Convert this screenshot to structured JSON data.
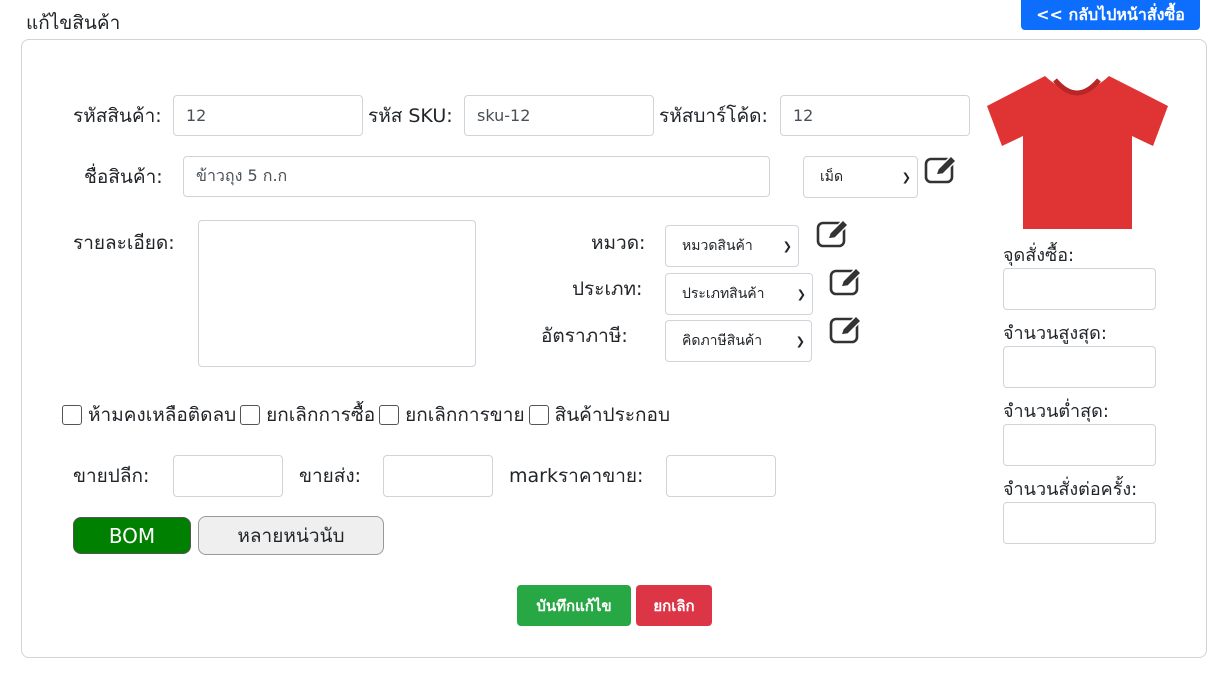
{
  "page": {
    "title": "แก้ไขสินค้า",
    "back_button": "<< กลับไปหน้าสั่งซื้อ"
  },
  "form": {
    "product_code": {
      "label": "รหัสสินค้า:",
      "value": "12"
    },
    "sku": {
      "label": "รหัส SKU:",
      "value": "sku-12"
    },
    "barcode": {
      "label": "รหัสบาร์โค้ด:",
      "value": "12"
    },
    "product_name": {
      "label": "ชื่อสินค้า:",
      "value": "ข้าวถุง 5 ก.ก"
    },
    "unit": {
      "selected": "เม็ด"
    },
    "description": {
      "label": "รายละเอียด:",
      "value": ""
    },
    "category": {
      "label": "หมวด:",
      "selected": "หมวดสินค้า"
    },
    "type": {
      "label": "ประเภท:",
      "selected": "ประเภทสินค้า"
    },
    "tax_rate": {
      "label": "อัตราภาษี:",
      "selected": "คิดภาษีสินค้า"
    },
    "checkboxes": [
      {
        "label": "ห้ามคงเหลือติดลบ",
        "checked": false
      },
      {
        "label": "ยกเลิกการซื้อ",
        "checked": false
      },
      {
        "label": "ยกเลิกการขาย",
        "checked": false
      },
      {
        "label": "สินค้าประกอบ",
        "checked": false
      }
    ],
    "retail_price": {
      "label": "ขายปลีก:",
      "value": ""
    },
    "wholesale_price": {
      "label": "ขายส่ง:",
      "value": ""
    },
    "markup_price": {
      "label": "markราคาขาย:",
      "value": ""
    },
    "bom_button": "BOM",
    "multi_unit_button": "หลายหน่วนับ",
    "save_button": "บันทึกแก้ไข",
    "cancel_button": "ยกเลิก"
  },
  "side": {
    "image_icon": "tshirt-icon",
    "tshirt_color": "#e03434",
    "reorder_point": {
      "label": "จุดสั่งซื้อ:",
      "value": ""
    },
    "max_qty": {
      "label": "จำนวนสูงสุด:",
      "value": ""
    },
    "min_qty": {
      "label": "จำนวนต่ำสุด:",
      "value": ""
    },
    "order_qty": {
      "label": "จำนวนสั่งต่อครั้ง:",
      "value": ""
    }
  },
  "colors": {
    "primary": "#0d6efd",
    "success": "#28a745",
    "danger": "#dc3545",
    "bom_green": "#008000"
  }
}
